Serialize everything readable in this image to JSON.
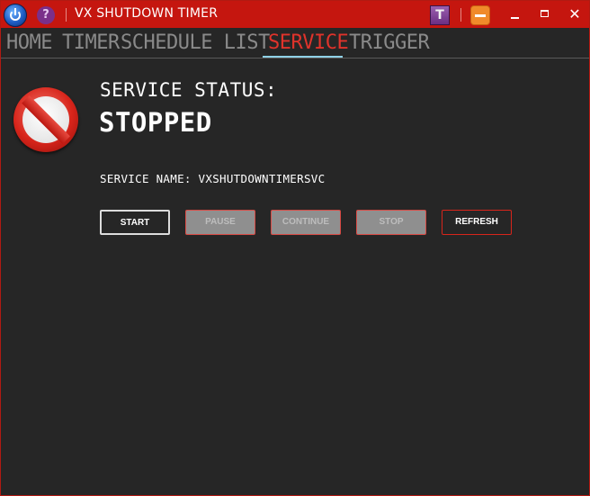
{
  "window": {
    "title": "VX SHUTDOWN TIMER",
    "help_glyph": "?",
    "t_glyph": "T",
    "close_glyph": "✕"
  },
  "tabs": [
    {
      "label": "HOME"
    },
    {
      "label": "TIMER"
    },
    {
      "label": "SCHEDULE LIST"
    },
    {
      "label": "SERVICE",
      "active": true
    },
    {
      "label": "TRIGGER"
    }
  ],
  "service": {
    "status_label": "SERVICE STATUS:",
    "status_value": "STOPPED",
    "name_line": "SERVICE NAME: VXSHUTDOWNTIMERSVC",
    "status_icon": "stop-sign-icon"
  },
  "buttons": {
    "start": "START",
    "pause": "PAUSE",
    "continue": "CONTINUE",
    "stop": "STOP",
    "refresh": "REFRESH"
  },
  "colors": {
    "titlebar": "#c5160f",
    "active_tab": "#e0332b",
    "inactive_tab": "#8a8a8a",
    "background": "#262626",
    "tab_underline": "#8fd1e6"
  }
}
